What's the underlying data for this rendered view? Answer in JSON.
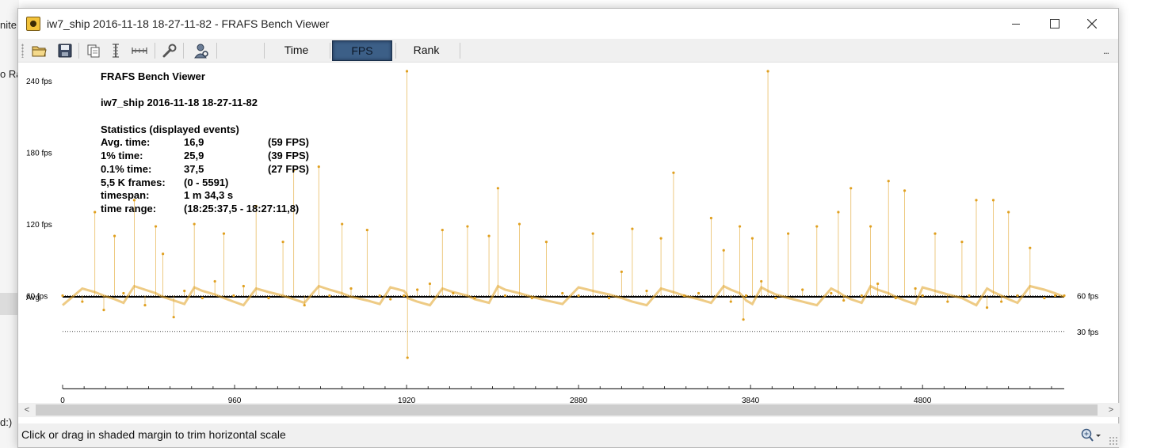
{
  "background": {
    "fragments": [
      "nite",
      "o Ra",
      "d:)"
    ]
  },
  "window": {
    "title": "iw7_ship 2016-11-18 18-27-11-82 - FRAFS Bench Viewer",
    "app_icon": "frafs-app-icon"
  },
  "toolbar": {
    "icons": [
      "open-folder-icon",
      "save-icon",
      "copy-icon",
      "vertical-scale-icon",
      "horizontal-scale-icon",
      "wrench-icon",
      "user-search-icon"
    ],
    "tabs": [
      {
        "label": "Time",
        "active": false
      },
      {
        "label": "FPS",
        "active": true
      },
      {
        "label": "Rank",
        "active": false
      }
    ],
    "more": "..."
  },
  "stats": {
    "app_name": "FRAFS Bench Viewer",
    "file_name": "iw7_ship 2016-11-18 18-27-11-82",
    "header": "Statistics (displayed events)",
    "rows": [
      {
        "label": "Avg. time:",
        "value": "16,9",
        "extra": "(59 FPS)"
      },
      {
        "label": "1% time:",
        "value": "25,9",
        "extra": "(39 FPS)"
      },
      {
        "label": "0.1% time:",
        "value": "37,5",
        "extra": "(27 FPS)"
      },
      {
        "label": "5,5 K frames:",
        "value": "(0 - 5591)",
        "extra": ""
      },
      {
        "label": "timespan:",
        "value": "1 m 34,3 s",
        "extra": ""
      },
      {
        "label": "time range:",
        "value": "(18:25:37,5 - 18:27:11,8)",
        "extra": ""
      }
    ]
  },
  "chart_data": {
    "type": "scatter",
    "title": "",
    "xlabel": "",
    "ylabel": "",
    "x_range": [
      0,
      5591
    ],
    "y_range": [
      0,
      250
    ],
    "x_ticks": [
      0,
      960,
      1920,
      2880,
      3840,
      4800
    ],
    "y_ticks": [
      {
        "value": 240,
        "label": "240 fps"
      },
      {
        "value": 180,
        "label": "180 fps"
      },
      {
        "value": 120,
        "label": "120 fps"
      },
      {
        "value": 60,
        "label": "60 fps"
      }
    ],
    "reference_lines": [
      {
        "value": 59,
        "label_left": "Avg",
        "style": "solid"
      },
      {
        "value": 60,
        "label_right": "60 fps",
        "style": "dotted"
      },
      {
        "value": 30,
        "label_right": "30 fps",
        "style": "dotted"
      }
    ],
    "series": [
      {
        "color": "#e0a020",
        "points": [
          [
            0,
            60
          ],
          [
            110,
            55
          ],
          [
            180,
            130
          ],
          [
            230,
            48
          ],
          [
            290,
            110
          ],
          [
            340,
            62
          ],
          [
            400,
            140
          ],
          [
            460,
            52
          ],
          [
            520,
            118
          ],
          [
            560,
            95
          ],
          [
            620,
            42
          ],
          [
            680,
            64
          ],
          [
            735,
            120
          ],
          [
            780,
            58
          ],
          [
            850,
            72
          ],
          [
            900,
            112
          ],
          [
            955,
            60
          ],
          [
            1010,
            68
          ],
          [
            1080,
            135
          ],
          [
            1150,
            58
          ],
          [
            1230,
            105
          ],
          [
            1290,
            165
          ],
          [
            1350,
            52
          ],
          [
            1430,
            168
          ],
          [
            1490,
            60
          ],
          [
            1560,
            120
          ],
          [
            1610,
            66
          ],
          [
            1700,
            115
          ],
          [
            1770,
            60
          ],
          [
            1830,
            57
          ],
          [
            1905,
            60
          ],
          [
            1922,
            248
          ],
          [
            1925,
            8
          ],
          [
            1980,
            65
          ],
          [
            2050,
            70
          ],
          [
            2120,
            115
          ],
          [
            2180,
            62
          ],
          [
            2260,
            118
          ],
          [
            2300,
            58
          ],
          [
            2380,
            110
          ],
          [
            2430,
            150
          ],
          [
            2470,
            60
          ],
          [
            2550,
            120
          ],
          [
            2620,
            58
          ],
          [
            2700,
            105
          ],
          [
            2790,
            62
          ],
          [
            2880,
            60
          ],
          [
            2960,
            112
          ],
          [
            3050,
            58
          ],
          [
            3120,
            80
          ],
          [
            3180,
            116
          ],
          [
            3260,
            64
          ],
          [
            3340,
            108
          ],
          [
            3410,
            163
          ],
          [
            3470,
            60
          ],
          [
            3550,
            62
          ],
          [
            3620,
            125
          ],
          [
            3690,
            98
          ],
          [
            3730,
            55
          ],
          [
            3780,
            118
          ],
          [
            3800,
            40
          ],
          [
            3815,
            60
          ],
          [
            3850,
            108
          ],
          [
            3900,
            72
          ],
          [
            3937,
            248
          ],
          [
            3980,
            58
          ],
          [
            4050,
            112
          ],
          [
            4130,
            65
          ],
          [
            4210,
            118
          ],
          [
            4290,
            62
          ],
          [
            4330,
            130
          ],
          [
            4360,
            56
          ],
          [
            4400,
            150
          ],
          [
            4460,
            60
          ],
          [
            4510,
            118
          ],
          [
            4550,
            70
          ],
          [
            4610,
            156
          ],
          [
            4650,
            58
          ],
          [
            4700,
            148
          ],
          [
            4760,
            66
          ],
          [
            4800,
            60
          ],
          [
            4870,
            112
          ],
          [
            4940,
            55
          ],
          [
            5020,
            105
          ],
          [
            5060,
            60
          ],
          [
            5100,
            140
          ],
          [
            5160,
            50
          ],
          [
            5195,
            140
          ],
          [
            5240,
            55
          ],
          [
            5280,
            130
          ],
          [
            5330,
            60
          ],
          [
            5400,
            100
          ],
          [
            5480,
            58
          ],
          [
            5540,
            60
          ],
          [
            5591,
            60
          ]
        ]
      }
    ]
  },
  "scrollbar": {
    "left": "<",
    "right": ">"
  },
  "status": {
    "text": "Click or drag in shaded margin to trim horizontal scale",
    "zoom_icon": "zoom-dropdown-icon"
  }
}
